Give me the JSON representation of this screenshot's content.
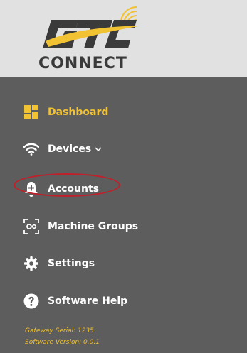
{
  "logo": {
    "top_text": "GTC",
    "bottom_text": "CONNECT"
  },
  "menu": {
    "items": [
      {
        "label": "Dashboard",
        "icon": "dashboard-icon",
        "active": true
      },
      {
        "label": "Devices",
        "icon": "wifi-icon",
        "has_dropdown": true
      },
      {
        "label": "Accounts",
        "icon": "bell-plus-icon"
      },
      {
        "label": "Machine Groups",
        "icon": "machine-group-icon"
      },
      {
        "label": "Settings",
        "icon": "gear-icon"
      },
      {
        "label": "Software Help",
        "icon": "question-circle-icon"
      }
    ]
  },
  "footer": {
    "gateway_serial": "Gateway Serial: 1235",
    "software_version": "Software Version: 0.0.1"
  },
  "colors": {
    "accent": "#f1c232",
    "sidebar_bg": "#5d5d5d",
    "logo_bg": "#e1e1e1",
    "highlight": "#c0202a"
  }
}
